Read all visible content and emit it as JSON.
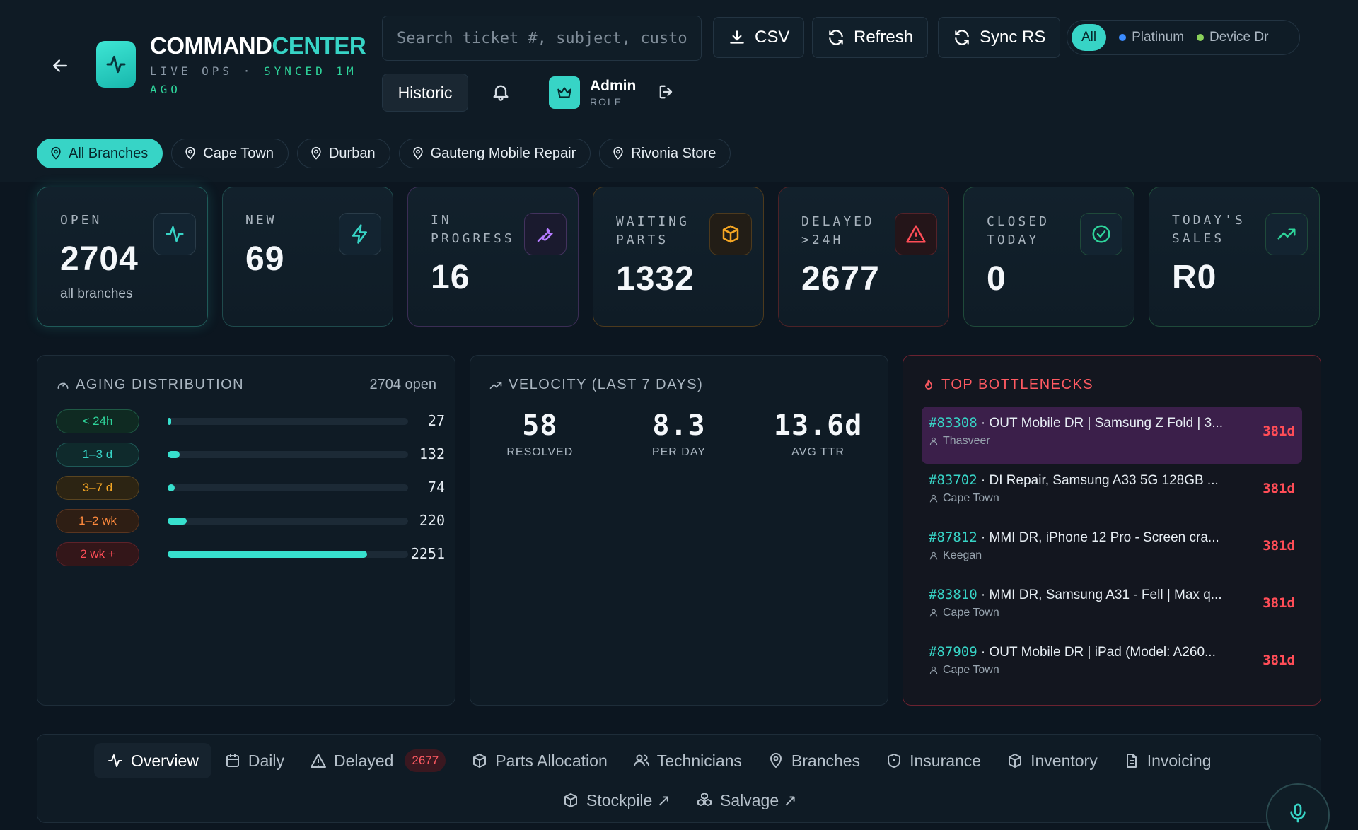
{
  "header": {
    "brand_part1": "COMMAND",
    "brand_part2": "CENTER",
    "live_ops": "LIVE OPS · ",
    "synced": "SYNCED 1M AGO",
    "search_placeholder": "Search ticket #, subject, customer",
    "csv_label": "CSV",
    "refresh_label": "Refresh",
    "sync_label": "Sync RS",
    "filter": {
      "all": "All",
      "platinum": "Platinum",
      "device": "Device Dr"
    },
    "filter_colors": {
      "platinum": "#3b8cff",
      "device": "#8ad15a"
    },
    "historic_label": "Historic",
    "user": {
      "name": "Admin",
      "role": "ROLE"
    }
  },
  "branches": [
    {
      "label": "All Branches",
      "active": true
    },
    {
      "label": "Cape Town",
      "active": false
    },
    {
      "label": "Durban",
      "active": false
    },
    {
      "label": "Gauteng Mobile Repair",
      "active": false
    },
    {
      "label": "Rivonia Store",
      "active": false
    }
  ],
  "kpis": [
    {
      "label": "OPEN",
      "value": "2704",
      "sub": "all branches",
      "icon": "activity-icon",
      "accent": "#37d4c6"
    },
    {
      "label": "NEW",
      "value": "69",
      "sub": "",
      "icon": "zap-icon",
      "accent": "#37d4c6"
    },
    {
      "label": "IN PROGRESS",
      "value": "16",
      "sub": "",
      "icon": "wrench-icon",
      "accent": "#b57bff"
    },
    {
      "label": "WAITING PARTS",
      "value": "1332",
      "sub": "",
      "icon": "package-icon",
      "accent": "#f5a623"
    },
    {
      "label": "DELAYED >24H",
      "value": "2677",
      "sub": "",
      "icon": "alert-triangle-icon",
      "accent": "#ff4d57"
    },
    {
      "label": "CLOSED TODAY",
      "value": "0",
      "sub": "",
      "icon": "check-circle-icon",
      "accent": "#2ed39a"
    },
    {
      "label": "TODAY'S SALES",
      "value": "R0",
      "sub": "",
      "icon": "trending-up-icon",
      "accent": "#2ed39a"
    }
  ],
  "aging": {
    "title": "AGING DISTRIBUTION",
    "open_label": "2704 open",
    "rows": [
      {
        "label": "< 24h",
        "count": "27",
        "fraction": 0.01,
        "color": "#2ed39a",
        "bg": "#0f2a22"
      },
      {
        "label": "1–3 d",
        "count": "132",
        "fraction": 0.05,
        "color": "#37d4c6",
        "bg": "#0f2a2c"
      },
      {
        "label": "3–7 d",
        "count": "74",
        "fraction": 0.03,
        "color": "#f5a623",
        "bg": "#2c2413"
      },
      {
        "label": "1–2 wk",
        "count": "220",
        "fraction": 0.08,
        "color": "#ff8a3d",
        "bg": "#2e1e14"
      },
      {
        "label": "2 wk +",
        "count": "2251",
        "fraction": 0.83,
        "color": "#ff4d57",
        "bg": "#331619"
      }
    ]
  },
  "velocity": {
    "title": "VELOCITY (LAST 7 DAYS)",
    "stats": [
      {
        "value": "58",
        "label": "RESOLVED"
      },
      {
        "value": "8.3",
        "label": "PER DAY"
      },
      {
        "value": "13.6d",
        "label": "AVG TTR"
      }
    ]
  },
  "bottlenecks": {
    "title": "TOP BOTTLENECKS",
    "items": [
      {
        "id": "#83308",
        "subject": "OUT Mobile DR | Samsung Z Fold | 3...",
        "owner": "Thasveer",
        "age": "381d"
      },
      {
        "id": "#83702",
        "subject": "DI Repair, Samsung A33 5G 128GB ...",
        "owner": "Cape Town",
        "age": "381d"
      },
      {
        "id": "#87812",
        "subject": "MMI DR, iPhone 12 Pro - Screen cra...",
        "owner": "Keegan",
        "age": "381d"
      },
      {
        "id": "#83810",
        "subject": "MMI DR, Samsung A31 - Fell | Max q...",
        "owner": "Cape Town",
        "age": "381d"
      },
      {
        "id": "#87909",
        "subject": "OUT Mobile DR | iPad (Model: A260...",
        "owner": "Cape Town",
        "age": "381d"
      }
    ]
  },
  "nav": {
    "overview": "Overview",
    "daily": "Daily",
    "delayed": "Delayed",
    "delayed_count": "2677",
    "parts": "Parts Allocation",
    "technicians": "Technicians",
    "branches": "Branches",
    "insurance": "Insurance",
    "inventory": "Inventory",
    "invoicing": "Invoicing",
    "stockpile": "Stockpile ↗",
    "salvage": "Salvage ↗"
  }
}
